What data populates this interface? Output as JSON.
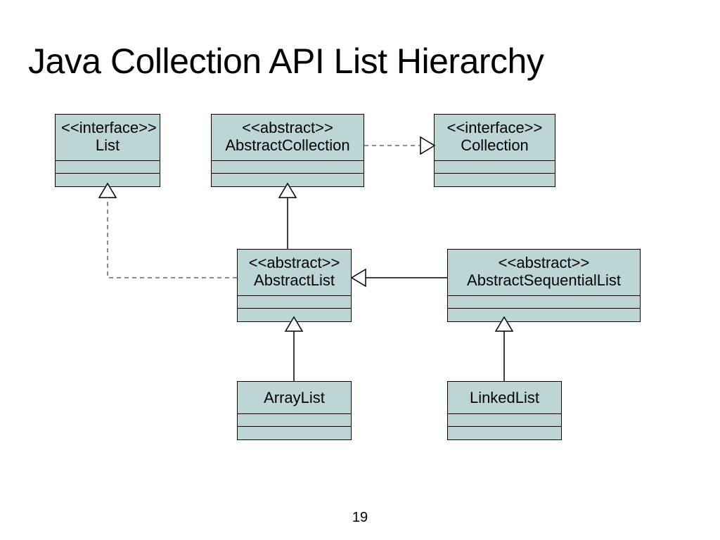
{
  "title": "Java Collection API List Hierarchy",
  "page_number": "19",
  "boxes": {
    "list": {
      "stereotype": "<<interface>>",
      "name": "List"
    },
    "abstractCollection": {
      "stereotype": "<<abstract>>",
      "name": "AbstractCollection"
    },
    "collection": {
      "stereotype": "<<interface>>",
      "name": "Collection"
    },
    "abstractList": {
      "stereotype": "<<abstract>>",
      "name": "AbstractList"
    },
    "abstractSequential": {
      "stereotype": "<<abstract>>",
      "name": "AbstractSequentialList"
    },
    "arrayList": {
      "stereotype": "",
      "name": "ArrayList"
    },
    "linkedList": {
      "stereotype": "",
      "name": "LinkedList"
    }
  },
  "relations": [
    {
      "from": "abstractCollection",
      "to": "collection",
      "style": "dashed",
      "type": "realization"
    },
    {
      "from": "abstractList",
      "to": "list",
      "style": "dashed",
      "type": "realization"
    },
    {
      "from": "abstractList",
      "to": "abstractCollection",
      "style": "solid",
      "type": "inheritance"
    },
    {
      "from": "abstractSequential",
      "to": "abstractList",
      "style": "solid",
      "type": "inheritance"
    },
    {
      "from": "arrayList",
      "to": "abstractList",
      "style": "solid",
      "type": "inheritance"
    },
    {
      "from": "linkedList",
      "to": "abstractSequential",
      "style": "solid",
      "type": "inheritance"
    }
  ]
}
